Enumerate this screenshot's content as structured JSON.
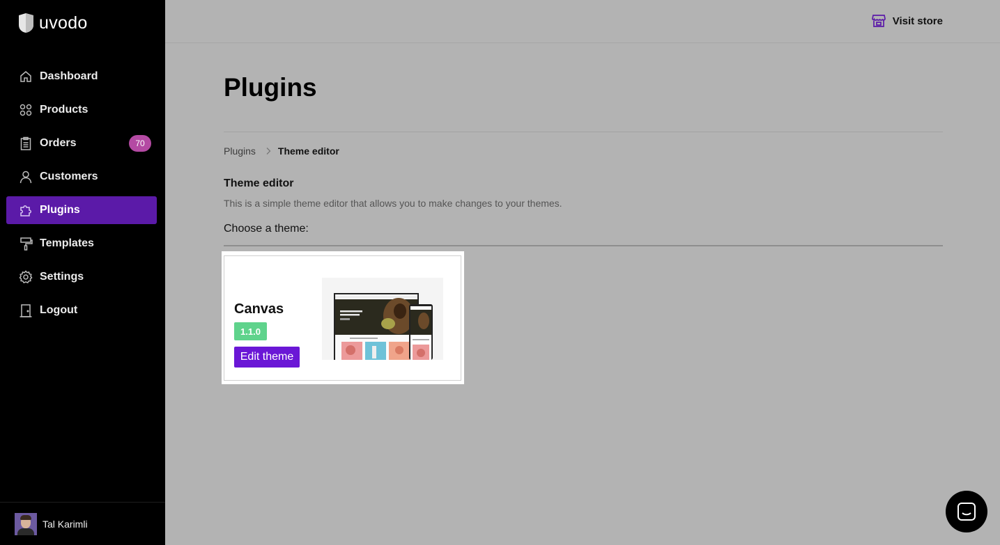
{
  "brand": {
    "name": "uvodo"
  },
  "sidebar": {
    "items": [
      {
        "label": "Dashboard",
        "icon": "home-icon"
      },
      {
        "label": "Products",
        "icon": "grid-icon"
      },
      {
        "label": "Orders",
        "icon": "clipboard-icon",
        "badge": "70"
      },
      {
        "label": "Customers",
        "icon": "user-icon"
      },
      {
        "label": "Plugins",
        "icon": "puzzle-icon",
        "active": true
      },
      {
        "label": "Templates",
        "icon": "paint-roller-icon"
      },
      {
        "label": "Settings",
        "icon": "gear-icon"
      },
      {
        "label": "Logout",
        "icon": "door-icon"
      }
    ],
    "user": {
      "name": "Tal Karimli"
    }
  },
  "header": {
    "visit_store": "Visit store"
  },
  "main": {
    "title": "Plugins",
    "breadcrumb": {
      "parent": "Plugins",
      "current": "Theme editor"
    },
    "section_title": "Theme editor",
    "section_desc": "This is a simple theme editor that allows you to make changes to your themes.",
    "choose_label": "Choose a theme:",
    "theme": {
      "name": "Canvas",
      "version": "1.1.0",
      "edit_label": "Edit theme"
    }
  },
  "colors": {
    "accent": "#6a17d6",
    "active_nav": "#5b1aa8",
    "badge": "#b44aa3",
    "version": "#5fd38c"
  }
}
